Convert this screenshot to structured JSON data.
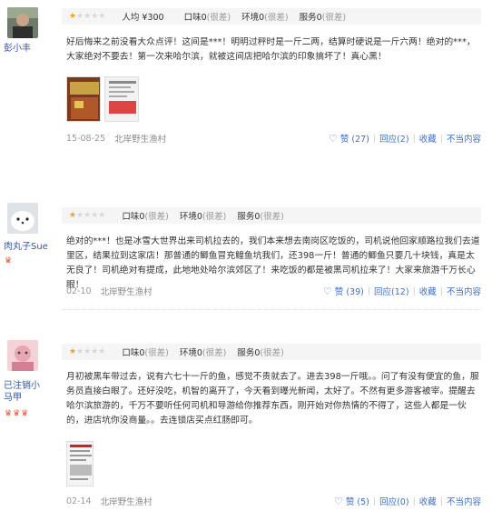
{
  "reviews": [
    {
      "user": "彭小丰",
      "avg_label": "人均",
      "avg_price": "¥300",
      "ratings": [
        {
          "label": "口味",
          "value": "0",
          "note": "(很差)"
        },
        {
          "label": "环境",
          "value": "0",
          "note": "(很差)"
        },
        {
          "label": "服务",
          "value": "0",
          "note": "(很差)"
        }
      ],
      "text": "好后悔来之前没看大众点评！这间是***！明明过秤时是一斤二两，结算时硬说是一斤六两！绝对的***，大家绝对不要去！第一次来哈尔滨，就被这间店把哈尔滨的印象搞坏了！真心黑！",
      "date": "15-08-25",
      "shop": "北岸野生渔村",
      "like": "赞",
      "like_count": "(27)",
      "reply": "回应",
      "reply_count": "(2)",
      "fav": "收藏",
      "report": "不当内容"
    },
    {
      "user": "肉丸子Sue",
      "crowns": "♛",
      "ratings": [
        {
          "label": "口味",
          "value": "0",
          "note": "(很差)"
        },
        {
          "label": "环境",
          "value": "0",
          "note": "(很差)"
        },
        {
          "label": "服务",
          "value": "0",
          "note": "(很差)"
        }
      ],
      "text": "绝对的***！也是冰雪大世界出来司机拉去的，我们本来想去南岗区吃饭的，司机说他回家顺路拉我们去道里区，结果拉到这家店！那普通的鲫鱼冒充鳇鱼坑我们，还398一斤！普通的鲫鱼只要几十块钱，真是太无良了！司机绝对有提成，此地地处哈尔滨郊区了！来吃饭的都是被黑司机拉来了！大家来旅游千万长心眼！",
      "date": "02-10",
      "shop": "北岸野生渔村",
      "like": "赞",
      "like_count": "(39)",
      "reply": "回应",
      "reply_count": "(12)",
      "fav": "收藏",
      "report": "不当内容"
    },
    {
      "user": "已注销小马甲",
      "crowns": "♛♛♛",
      "ratings": [
        {
          "label": "口味",
          "value": "0",
          "note": "(很差)"
        },
        {
          "label": "环境",
          "value": "0",
          "note": "(很差)"
        },
        {
          "label": "服务",
          "value": "0",
          "note": "(很差)"
        }
      ],
      "text": "月初被黑车带过去，说有六七十一斤的鱼，感觉不贵就去了。进去398一斤哦。。问了有没有便宜的鱼，服务员直接白眼了。还好没吃，机智的离开了，今天看到曝光新闻，太好了。不然有更多游客被宰。提醒去哈尔滨旅游的，千万不要听任何司机和导游给你推荐东西，刚开始对你热情的不得了，这些人都是一伙的，进店坑你没商量。。去连锁店买点红肠即可。",
      "date": "02-14",
      "shop": "北岸野生渔村",
      "like": "赞",
      "like_count": "(5)",
      "reply": "回应",
      "reply_count": "(0)",
      "fav": "收藏",
      "report": "不当内容"
    }
  ]
}
